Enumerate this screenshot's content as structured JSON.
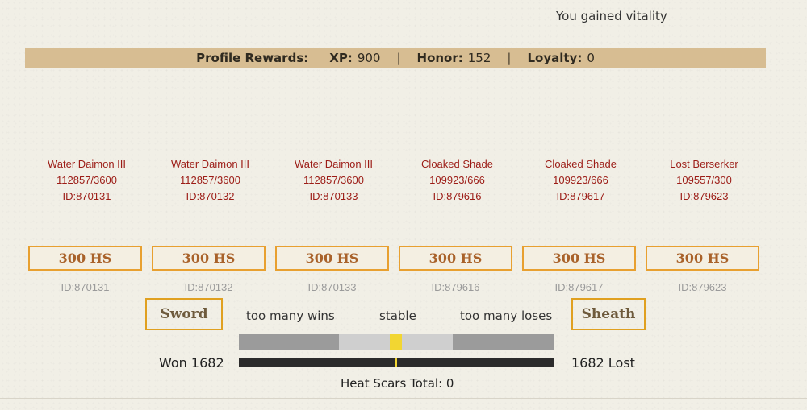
{
  "notice": "You gained vitality",
  "rewards": {
    "label": "Profile Rewards:",
    "xp_label": "XP:",
    "xp_value": "900",
    "honor_label": "Honor:",
    "honor_value": "152",
    "loyalty_label": "Loyalty:",
    "loyalty_value": "0",
    "separator": "|"
  },
  "enemies": [
    {
      "name": "Water Daimon III",
      "hp": "112857/3600",
      "id": "ID:870131",
      "button": "300 HS"
    },
    {
      "name": "Water Daimon III",
      "hp": "112857/3600",
      "id": "ID:870132",
      "button": "300 HS"
    },
    {
      "name": "Water Daimon III",
      "hp": "112857/3600",
      "id": "ID:870133",
      "button": "300 HS"
    },
    {
      "name": "Cloaked Shade",
      "hp": "109923/666",
      "id": "ID:879616",
      "button": "300 HS"
    },
    {
      "name": "Cloaked Shade",
      "hp": "109923/666",
      "id": "ID:879617",
      "button": "300 HS"
    },
    {
      "name": "Lost Berserker",
      "hp": "109557/300",
      "id": "ID:879623",
      "button": "300 HS"
    }
  ],
  "balance": {
    "sword_label": "Sword",
    "sheath_label": "Sheath",
    "too_many_wins": "too many wins",
    "stable": "stable",
    "too_many_loses": "too many loses",
    "won_text": "Won 1682",
    "lost_text": "1682 Lost",
    "heat_scars": "Heat Scars Total: 0",
    "marker_position": 0.5,
    "colors": {
      "dark": "#9b9b9b",
      "light": "#cfcfcf",
      "marker": "#f2d632",
      "bar": "#2b2b2b"
    }
  }
}
